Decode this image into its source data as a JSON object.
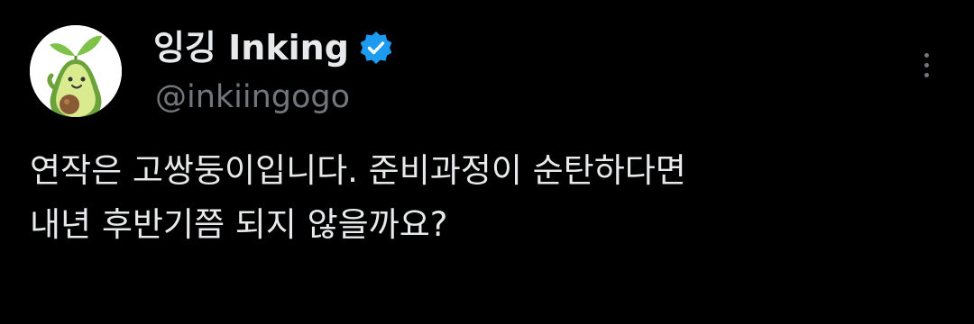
{
  "tweet": {
    "author": {
      "display_name": "잉깅 Inking",
      "handle": "@inkiingogo",
      "verified": true,
      "avatar_icon": "avocado-avatar-icon"
    },
    "text_lines": [
      "연작은 고쌍둥이입니다. 준비과정이 순탄하다면",
      "내년 후반기쯤 되지 않을까요?"
    ],
    "more_icon": "more-options-icon"
  },
  "colors": {
    "background": "#000000",
    "text_primary": "#e7e9ea",
    "text_secondary": "#71767b",
    "verified_blue": "#1d9bf0"
  }
}
